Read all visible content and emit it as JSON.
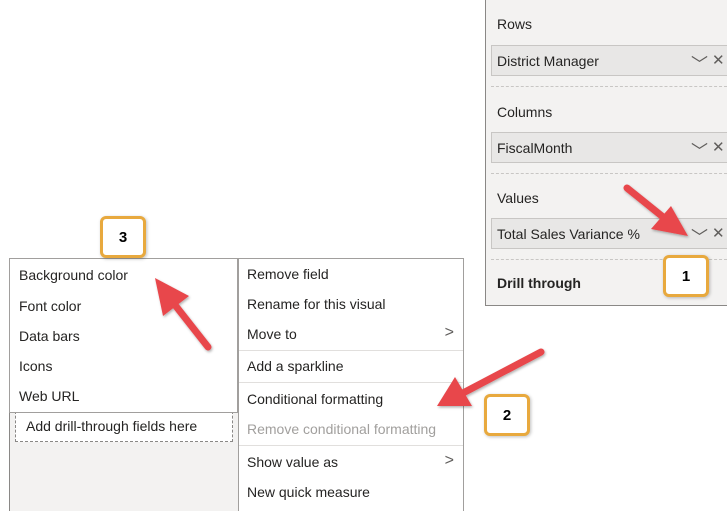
{
  "fields_pane": {
    "rows_label": "Rows",
    "rows_field": "District Manager",
    "columns_label": "Columns",
    "columns_field": "FiscalMonth",
    "values_label": "Values",
    "values_field": "Total Sales Variance %",
    "drill_through_label": "Drill through",
    "chevron_icon": "chevron-down-icon",
    "close_icon": "close-icon"
  },
  "left_pane": {
    "drop_zone_text": "Add drill-through fields here"
  },
  "context_menu": {
    "items": [
      {
        "label": "Remove field"
      },
      {
        "label": "Rename for this visual"
      },
      {
        "label": "Move to"
      },
      {
        "label": "Add a sparkline"
      },
      {
        "label": "Conditional formatting"
      },
      {
        "label": "Remove conditional formatting"
      },
      {
        "label": "Show value as"
      },
      {
        "label": "New quick measure"
      }
    ]
  },
  "sub_menu": {
    "items": [
      {
        "label": "Background color"
      },
      {
        "label": "Font color"
      },
      {
        "label": "Data bars"
      },
      {
        "label": "Icons"
      },
      {
        "label": "Web URL"
      }
    ]
  },
  "callouts": [
    "1",
    "2",
    "3"
  ],
  "colors": {
    "arrow": "#e8474c",
    "callout_border": "#e8a93e",
    "pane_bg": "#f3f2f1",
    "well_bg": "#e8e7e6"
  }
}
